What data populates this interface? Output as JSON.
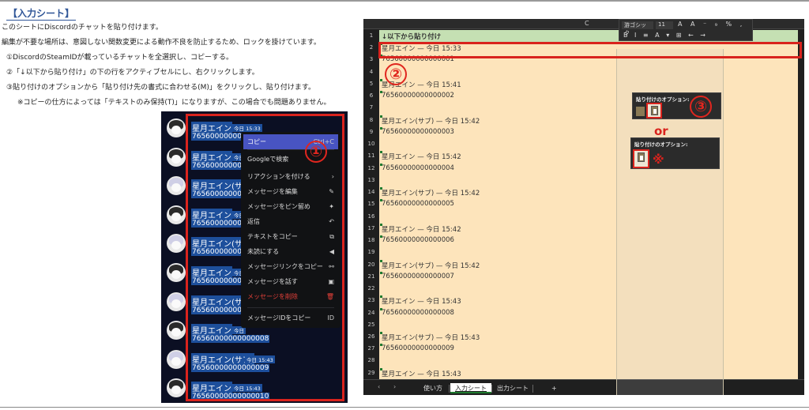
{
  "instructions": {
    "heading": "【入力シート】",
    "lines": [
      "このシートにDiscordのチャットを貼り付けます。",
      "編集が不要な場所は、意図しない関数変更による動作不良を防止するため、ロックを掛けています。",
      "①DiscordのSteamIDが載っているチャットを全選択し、コピーする。",
      "②「↓以下から貼り付け」の下の行をアクティブセルにし、右クリックします。",
      "③貼り付けのオプションから「貼り付け先の書式に合わせる(M)」をクリックし、貼り付けます。",
      "※コピーの仕方によっては「テキストのみ保持(T)」になりますが、この場合でも問題ありません。"
    ]
  },
  "discord": {
    "messages": [
      {
        "name": "星月エイン",
        "time": "今日 15:33",
        "num": "76560000000000001"
      },
      {
        "name": "星月エイン",
        "time": "今日",
        "num": "76560000000000002"
      },
      {
        "name": "星月エイン(サブ)",
        "time": "",
        "num": "76560000000000003"
      },
      {
        "name": "星月エイン",
        "time": "今日",
        "num": "76560000000000004"
      },
      {
        "name": "星月エイン(サブ)",
        "time": "",
        "num": "76560000000000005"
      },
      {
        "name": "星月エイン",
        "time": "今日",
        "num": "76560000000000006"
      },
      {
        "name": "星月エイン(サブ)",
        "time": "",
        "num": "76560000000000007"
      },
      {
        "name": "星月エイン",
        "time": "今日",
        "num": "76560000000000008"
      },
      {
        "name": "星月エイン(サブ)",
        "time": "今日 15:43",
        "num": "76560000000000009"
      },
      {
        "name": "星月エイン",
        "time": "今日 15:43",
        "num": "76560000000000010"
      }
    ],
    "context_menu": [
      {
        "label": "コピー",
        "shortcut": "Ctrl+C"
      },
      {
        "label": "Googleで検索",
        "shortcut": ""
      },
      {
        "label": "リアクションを付ける",
        "shortcut": "›"
      },
      {
        "label": "メッセージを編集",
        "shortcut": "✎"
      },
      {
        "label": "メッセージをピン留め",
        "shortcut": "✦"
      },
      {
        "label": "返信",
        "shortcut": "↶"
      },
      {
        "label": "テキストをコピー",
        "shortcut": "⧉"
      },
      {
        "label": "未読にする",
        "shortcut": "◀"
      },
      {
        "label": "メッセージリンクをコピー",
        "shortcut": "⚯"
      },
      {
        "label": "メッセージを話す",
        "shortcut": "▣"
      },
      {
        "label": "メッセージを削除",
        "shortcut": "🗑"
      },
      {
        "label": "メッセージIDをコピー",
        "shortcut": "ID"
      }
    ],
    "badge": "①"
  },
  "excel": {
    "column_c": "C",
    "row1": "↓以下から貼り付け",
    "row_numbers": [
      "1",
      "2",
      "3",
      "4",
      "5",
      "6",
      "7",
      "8",
      "9",
      "10",
      "11",
      "12",
      "13",
      "14",
      "15",
      "16",
      "17",
      "18",
      "19",
      "20",
      "21",
      "22",
      "23",
      "24",
      "25",
      "26",
      "27",
      "28",
      "29"
    ],
    "cells": [
      {
        "row": 2,
        "text": "星月エイン — 今日 15:33"
      },
      {
        "row": 3,
        "text": "76560000000000001"
      },
      {
        "row": 5,
        "text": "星月エイン — 今日 15:41"
      },
      {
        "row": 6,
        "text": "76560000000000002"
      },
      {
        "row": 8,
        "text": "星月エイン(サブ) — 今日 15:42"
      },
      {
        "row": 9,
        "text": "76560000000000003"
      },
      {
        "row": 11,
        "text": "星月エイン — 今日 15:42"
      },
      {
        "row": 12,
        "text": "76560000000000004"
      },
      {
        "row": 14,
        "text": "星月エイン(サブ) — 今日 15:42"
      },
      {
        "row": 15,
        "text": "76560000000000005"
      },
      {
        "row": 17,
        "text": "星月エイン — 今日 15:42"
      },
      {
        "row": 18,
        "text": "76560000000000006"
      },
      {
        "row": 20,
        "text": "星月エイン(サブ) — 今日 15:42"
      },
      {
        "row": 21,
        "text": "76560000000000007"
      },
      {
        "row": 23,
        "text": "星月エイン — 今日 15:43"
      },
      {
        "row": 24,
        "text": "76560000000000008"
      },
      {
        "row": 26,
        "text": "星月エイン(サブ) — 今日 15:43"
      },
      {
        "row": 27,
        "text": "76560000000000009"
      },
      {
        "row": 29,
        "text": "星月エイン — 今日 15:43"
      }
    ],
    "toolbar": {
      "font": "游ゴシック",
      "size": "11",
      "row1_icons": "A A ⁻ ₉ % ,",
      "row2_icons": "B I ≡ A ▾ ⊞ ← →"
    },
    "paste_title": "貼り付けのオプション:",
    "or_label": "or",
    "mark": "※",
    "badge2": "②",
    "badge3": "③",
    "tabs": [
      "使い方",
      "入力シート",
      "出力シート",
      "+"
    ],
    "nav_left": "‹",
    "nav_right": "›"
  },
  "colors": {
    "highlight": "#d9231d",
    "sheet_bg": "#fde4bb",
    "discord_select": "#1d4f9c",
    "menu_active": "#4854c2"
  }
}
